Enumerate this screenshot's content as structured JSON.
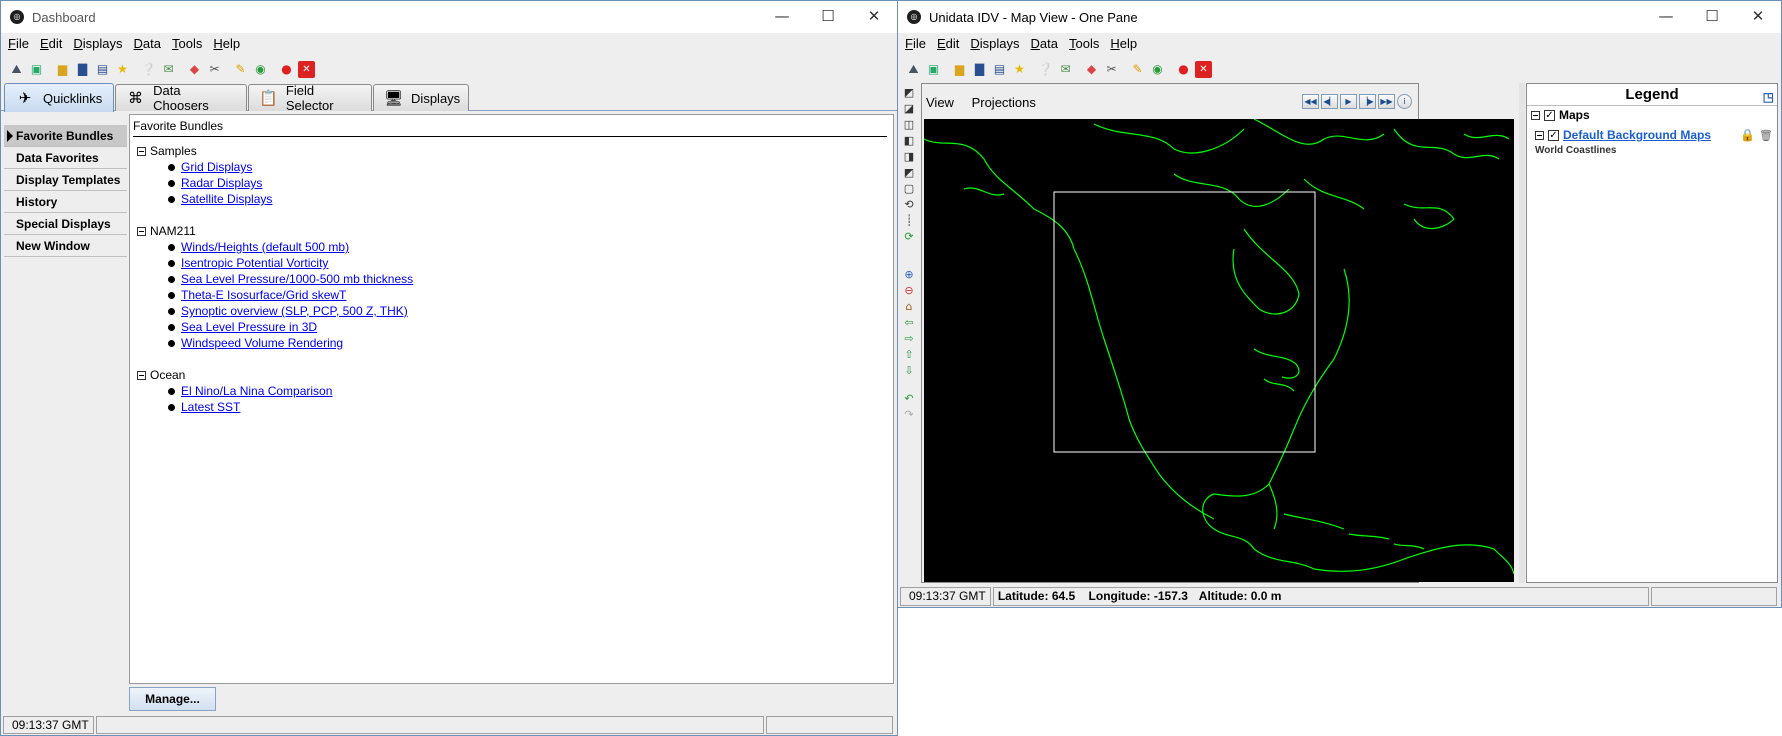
{
  "dashboard": {
    "title": "Dashboard",
    "menus": [
      "File",
      "Edit",
      "Displays",
      "Data",
      "Tools",
      "Help"
    ],
    "tabs": [
      "Quicklinks",
      "Data Choosers",
      "Field Selector",
      "Displays"
    ],
    "sidebar": [
      "Favorite Bundles",
      "Data Favorites",
      "Display Templates",
      "History",
      "Special Displays",
      "New Window"
    ],
    "content_title": "Favorite Bundles",
    "groups": [
      {
        "name": "Samples",
        "items": [
          "Grid Displays",
          "Radar Displays",
          "Satellite Displays"
        ]
      },
      {
        "name": "NAM211",
        "items": [
          "Winds/Heights (default 500 mb)",
          "Isentropic Potential Vorticity",
          "Sea Level Pressure/1000-500 mb thickness",
          "Theta-E Isosurface/Grid skewT",
          "Synoptic overview (SLP, PCP, 500 Z, THK)",
          "Sea Level Pressure in 3D",
          "Windspeed Volume Rendering"
        ]
      },
      {
        "name": "Ocean",
        "items": [
          "El Nino/La Nina Comparison",
          "Latest SST"
        ]
      }
    ],
    "manage_label": "Manage...",
    "status_time": "09:13:37 GMT"
  },
  "mapview": {
    "title": "Unidata IDV - Map View - One Pane",
    "menus": [
      "File",
      "Edit",
      "Displays",
      "Data",
      "Tools",
      "Help"
    ],
    "view_menus": [
      "View",
      "Projections"
    ],
    "legend_title": "Legend",
    "legend_group": "Maps",
    "legend_item": "Default Background Maps",
    "legend_sub": "World Coastlines",
    "status_time": "09:13:37 GMT",
    "lat_label": "Latitude:",
    "lat_value": "64.5",
    "lon_label": "Longitude:",
    "lon_value": "-157.3",
    "alt_label": "Altitude:",
    "alt_value": "0.0 m"
  },
  "colors": {
    "coastline": "#00ff00",
    "map_bg": "#000000",
    "link": "#0000ee",
    "tab_active": "#c7daf0"
  }
}
